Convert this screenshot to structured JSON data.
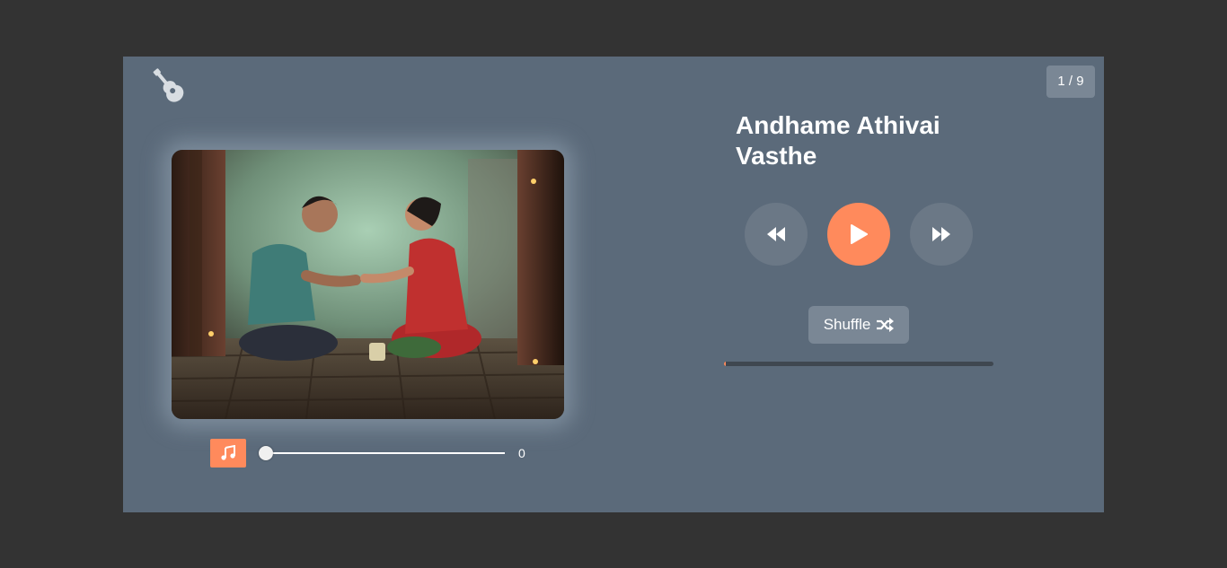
{
  "player": {
    "logo_icon": "guitar-icon",
    "track_counter": "1 / 9",
    "track_title": "Andhame Athivai Vasthe",
    "album_art_alt": "Album art",
    "controls": {
      "prev_icon": "backward-icon",
      "play_icon": "play-icon",
      "next_icon": "forward-icon"
    },
    "shuffle": {
      "label": "Shuffle",
      "icon": "shuffle-icon"
    },
    "progress_fraction": 0.005,
    "volume": {
      "icon": "music-note-icon",
      "value": "0",
      "level_fraction": 0.0
    }
  },
  "colors": {
    "page_bg": "#333333",
    "panel_bg": "#5b6a7a",
    "accent": "#ff8a5c",
    "button_bg": "#6b7886",
    "badge_bg": "#7a8795",
    "progress_track": "#3f4750",
    "text": "#ffffff"
  }
}
